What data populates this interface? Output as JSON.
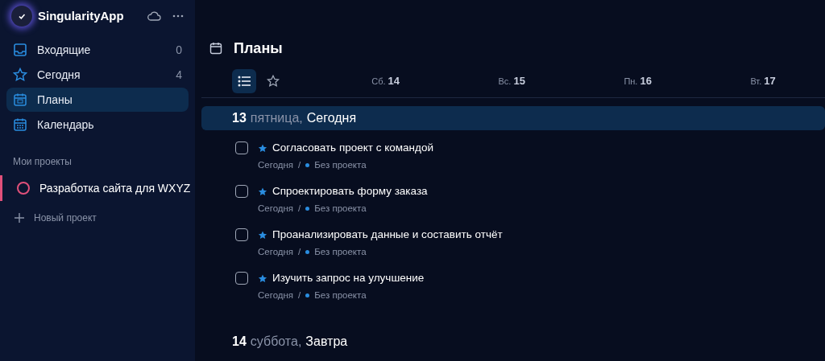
{
  "app": {
    "name": "SingularityApp"
  },
  "sidebar": {
    "items": [
      {
        "kind": "inbox",
        "label": "Входящие",
        "count": "0",
        "selected": false
      },
      {
        "kind": "today",
        "label": "Сегодня",
        "count": "4",
        "selected": false
      },
      {
        "kind": "plans",
        "label": "Планы",
        "selected": true
      },
      {
        "kind": "calendar",
        "label": "Календарь",
        "selected": false
      }
    ],
    "section_title": "Мои проекты",
    "projects": [
      {
        "name": "Разработка сайта для WXYZ",
        "color": "#e0507a"
      }
    ],
    "new_project": "Новый проект"
  },
  "main": {
    "title": "Планы",
    "views": [
      {
        "kind": "list",
        "selected": true
      },
      {
        "kind": "star",
        "selected": false
      }
    ],
    "week": [
      {
        "weekday": "Сб.",
        "day": "14"
      },
      {
        "weekday": "Вс.",
        "day": "15"
      },
      {
        "weekday": "Пн.",
        "day": "16"
      },
      {
        "weekday": "Вт.",
        "day": "17"
      }
    ],
    "days": [
      {
        "day": "13",
        "weekday": "пятница,",
        "label": "Сегодня",
        "selected": true,
        "tasks": [
          {
            "title": "Согласовать проект с командой",
            "starred": true,
            "checked": false,
            "when": "Сегодня",
            "separator": "/",
            "project": "Без проекта"
          },
          {
            "title": "Спроектировать форму заказа",
            "starred": true,
            "checked": false,
            "when": "Сегодня",
            "separator": "/",
            "project": "Без проекта"
          },
          {
            "title": "Проанализировать данные и составить отчёт",
            "starred": true,
            "checked": false,
            "when": "Сегодня",
            "separator": "/",
            "project": "Без проекта"
          },
          {
            "title": "Изучить запрос на улучшение",
            "starred": true,
            "checked": false,
            "when": "Сегодня",
            "separator": "/",
            "project": "Без проекта"
          }
        ]
      },
      {
        "day": "14",
        "weekday": "суббота,",
        "label": "Завтра",
        "selected": false
      }
    ]
  }
}
